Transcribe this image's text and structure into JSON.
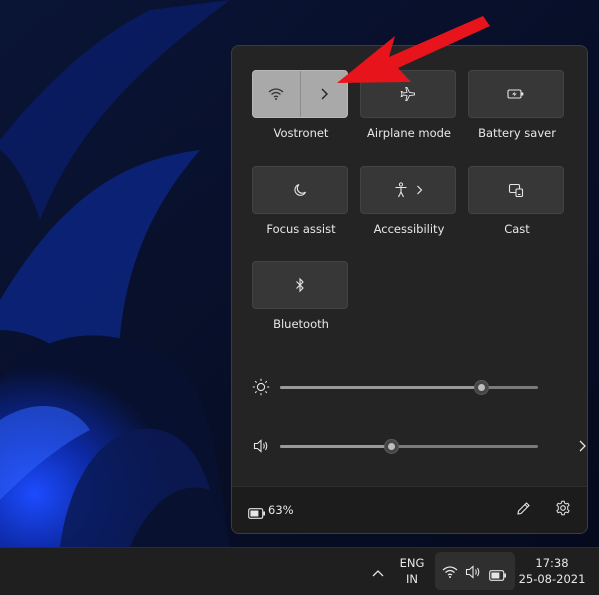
{
  "quick_settings": {
    "tiles": [
      {
        "label": "Vostronet",
        "icon": "wifi-icon",
        "secondary_icon": "chevron-right-icon",
        "active": true
      },
      {
        "label": "Airplane mode",
        "icon": "airplane-icon",
        "active": false
      },
      {
        "label": "Battery saver",
        "icon": "battery-saver-icon",
        "active": false
      },
      {
        "label": "Focus assist",
        "icon": "moon-icon",
        "active": false
      },
      {
        "label": "Accessibility",
        "icon": "accessibility-icon",
        "secondary_icon": "chevron-right-icon",
        "active": false
      },
      {
        "label": "Cast",
        "icon": "cast-icon",
        "active": false
      },
      {
        "label": "Bluetooth",
        "icon": "bluetooth-icon",
        "active": false
      }
    ],
    "brightness": {
      "icon": "sun-icon",
      "level_percent": 78
    },
    "volume": {
      "icon": "speaker-icon",
      "level_percent": 43,
      "arrow_icon": "chevron-right-icon"
    },
    "footer": {
      "battery_icon": "battery-icon",
      "battery_text": "63%",
      "edit_icon": "pencil-icon",
      "settings_icon": "gear-icon"
    }
  },
  "taskbar": {
    "overflow_icon": "chevron-up-icon",
    "language_line1": "ENG",
    "language_line2": "IN",
    "tray_icons": [
      "wifi-icon",
      "speaker-icon",
      "battery-icon"
    ],
    "time": "17:38",
    "date": "25-08-2021"
  },
  "colors": {
    "panel_bg": "#242424",
    "tile_off": "#373737",
    "tile_on": "#a9a9a9",
    "taskbar_bg": "#1f1f1f",
    "annotation_arrow": "#e8141c"
  }
}
